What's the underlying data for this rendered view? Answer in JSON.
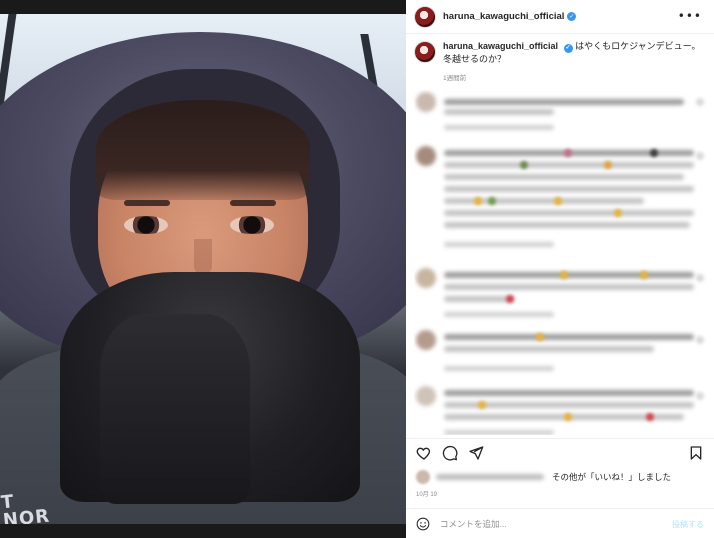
{
  "post": {
    "username": "haruna_kawaguchi_official",
    "verified": true,
    "caption": "はやくもロケジャンデビュー。冬越せるのか？",
    "caption_time": "1週間前",
    "photo": {
      "jacket_print_line1": "T",
      "jacket_print_line2": "NOR"
    }
  },
  "comments_blurred": true,
  "actions": {
    "like_icon": "heart-icon",
    "comment_icon": "comment-bubble-icon",
    "share_icon": "paper-plane-icon",
    "save_icon": "bookmark-icon"
  },
  "likes": {
    "text": "その他が「いいね！」しました"
  },
  "date": "10月 19",
  "comment_box": {
    "emoji_icon": "smile-icon",
    "placeholder": "コメントを追加...",
    "post_label": "投稿する"
  },
  "colors": {
    "verified": "#3897f0",
    "post_button_disabled": "#b2dffc",
    "muted_text": "#8e8e8e"
  }
}
